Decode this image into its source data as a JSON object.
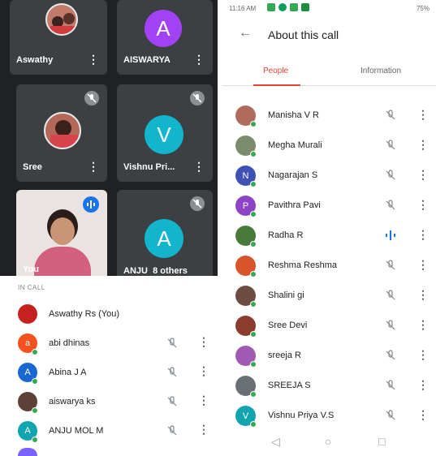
{
  "left": {
    "tiles": [
      {
        "name": "Aswathy"
      },
      {
        "name": "AISWARYA",
        "initial": "A",
        "color": "#a142f4"
      },
      {
        "name": "Sree"
      },
      {
        "name": "Vishnu Pri...",
        "initial": "V",
        "color": "#12b5cb"
      },
      {
        "name": "You"
      },
      {
        "name": "ANJU",
        "initial": "A",
        "color": "#12b5cb",
        "others": "8 others"
      }
    ],
    "in_call_label": "IN CALL",
    "participants": [
      {
        "name": "Aswathy Rs (You)",
        "color": "#c5221f",
        "initial": ""
      },
      {
        "name": "abi dhinas",
        "color": "#f4511e",
        "initial": "a"
      },
      {
        "name": "Abina J A",
        "color": "#1967d2",
        "initial": "A"
      },
      {
        "name": "aiswarya ks",
        "color": "#5d4037",
        "initial": ""
      },
      {
        "name": "ANJU MOL M",
        "color": "#12a4af",
        "initial": "A"
      }
    ]
  },
  "right": {
    "status": {
      "time": "11:16 AM",
      "battery": "75%"
    },
    "title": "About this call",
    "tabs": {
      "people": "People",
      "information": "Information"
    },
    "participants": [
      {
        "name": "Manisha V R",
        "color": "#b06b5f",
        "initial": "",
        "speaking": false
      },
      {
        "name": "Megha Murali",
        "color": "#7a8c6b",
        "initial": "",
        "speaking": false
      },
      {
        "name": "Nagarajan S",
        "color": "#3f51b5",
        "initial": "N",
        "speaking": false
      },
      {
        "name": "Pavithra Pavi",
        "color": "#8e44c7",
        "initial": "P",
        "speaking": false
      },
      {
        "name": "Radha R",
        "color": "#4a7a3a",
        "initial": "",
        "speaking": true
      },
      {
        "name": "Reshma Reshma",
        "color": "#d9542b",
        "initial": "",
        "speaking": false
      },
      {
        "name": "Shalini gi",
        "color": "#6d4c41",
        "initial": "",
        "speaking": false
      },
      {
        "name": "Sree Devi",
        "color": "#8d3b2e",
        "initial": "",
        "speaking": false
      },
      {
        "name": "sreeja R",
        "color": "#a05ab4",
        "initial": "",
        "speaking": false
      },
      {
        "name": "SREEJA S",
        "color": "#6a6f75",
        "initial": "",
        "speaking": false
      },
      {
        "name": "Vishnu Priya V.S",
        "color": "#12a4af",
        "initial": "V",
        "speaking": false
      }
    ]
  },
  "colors": {
    "accent": "#ea4335",
    "speaking": "#1a73e8",
    "online": "#34a853"
  }
}
